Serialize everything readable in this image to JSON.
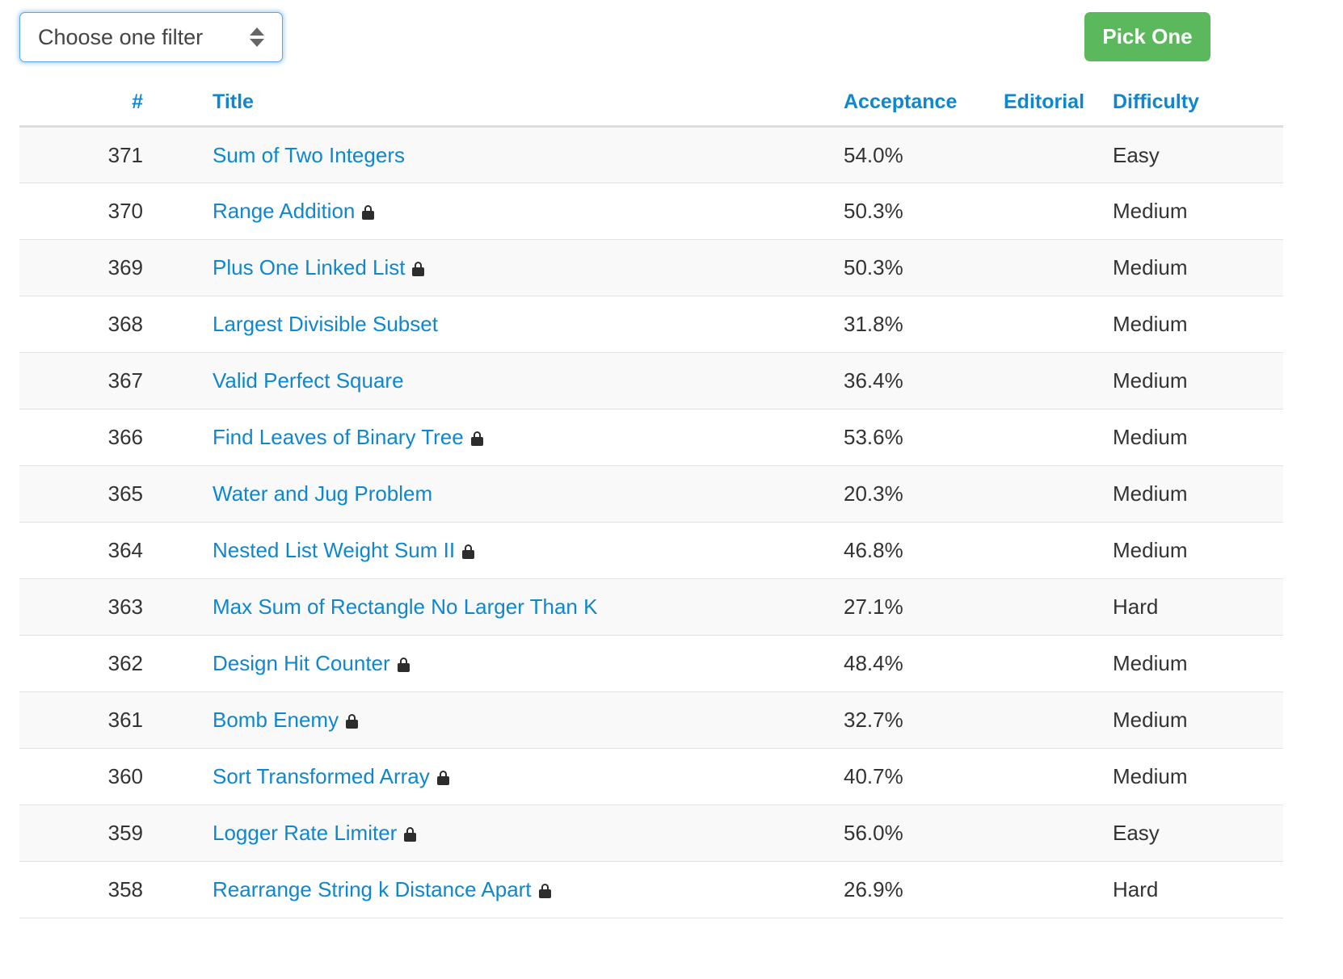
{
  "toolbar": {
    "filter_select": {
      "selected": "Choose one filter",
      "stepper_icon": "stepper-arrows-icon"
    },
    "pick_one_button": "Pick One"
  },
  "accent_colors": {
    "link_blue": "#0f87cf",
    "button_green": "#5cb85c",
    "focus_ring_blue": "#5aa7e8",
    "row_stripe": "#f9f9f9",
    "lock_dark": "#2d2d2d"
  },
  "table": {
    "columns": [
      {
        "key": "num",
        "label": "#"
      },
      {
        "key": "title",
        "label": "Title"
      },
      {
        "key": "acceptance",
        "label": "Acceptance"
      },
      {
        "key": "editorial",
        "label": "Editorial"
      },
      {
        "key": "difficulty",
        "label": "Difficulty"
      }
    ],
    "rows": [
      {
        "num": "371",
        "title": "Sum of Two Integers",
        "locked": false,
        "acceptance": "54.0%",
        "editorial": "",
        "difficulty": "Easy"
      },
      {
        "num": "370",
        "title": "Range Addition",
        "locked": true,
        "acceptance": "50.3%",
        "editorial": "",
        "difficulty": "Medium"
      },
      {
        "num": "369",
        "title": "Plus One Linked List",
        "locked": true,
        "acceptance": "50.3%",
        "editorial": "",
        "difficulty": "Medium"
      },
      {
        "num": "368",
        "title": "Largest Divisible Subset",
        "locked": false,
        "acceptance": "31.8%",
        "editorial": "",
        "difficulty": "Medium"
      },
      {
        "num": "367",
        "title": "Valid Perfect Square",
        "locked": false,
        "acceptance": "36.4%",
        "editorial": "",
        "difficulty": "Medium"
      },
      {
        "num": "366",
        "title": "Find Leaves of Binary Tree",
        "locked": true,
        "acceptance": "53.6%",
        "editorial": "",
        "difficulty": "Medium"
      },
      {
        "num": "365",
        "title": "Water and Jug Problem",
        "locked": false,
        "acceptance": "20.3%",
        "editorial": "",
        "difficulty": "Medium"
      },
      {
        "num": "364",
        "title": "Nested List Weight Sum II",
        "locked": true,
        "acceptance": "46.8%",
        "editorial": "",
        "difficulty": "Medium"
      },
      {
        "num": "363",
        "title": "Max Sum of Rectangle No Larger Than K",
        "locked": false,
        "acceptance": "27.1%",
        "editorial": "",
        "difficulty": "Hard"
      },
      {
        "num": "362",
        "title": "Design Hit Counter",
        "locked": true,
        "acceptance": "48.4%",
        "editorial": "",
        "difficulty": "Medium"
      },
      {
        "num": "361",
        "title": "Bomb Enemy",
        "locked": true,
        "acceptance": "32.7%",
        "editorial": "",
        "difficulty": "Medium"
      },
      {
        "num": "360",
        "title": "Sort Transformed Array",
        "locked": true,
        "acceptance": "40.7%",
        "editorial": "",
        "difficulty": "Medium"
      },
      {
        "num": "359",
        "title": "Logger Rate Limiter",
        "locked": true,
        "acceptance": "56.0%",
        "editorial": "",
        "difficulty": "Easy"
      },
      {
        "num": "358",
        "title": "Rearrange String k Distance Apart",
        "locked": true,
        "acceptance": "26.9%",
        "editorial": "",
        "difficulty": "Hard"
      }
    ]
  }
}
